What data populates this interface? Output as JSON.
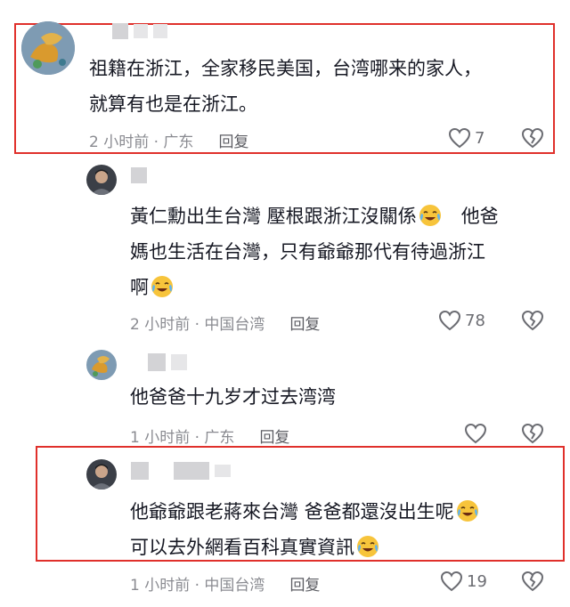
{
  "comments": [
    {
      "id": "c1",
      "lines": [
        "祖籍在浙江，全家移民美国，台湾哪来的家人，",
        "就算有也是在浙江。"
      ],
      "time": "2 小时前 · 广东",
      "reply": "回复",
      "likes": "7",
      "highlighted": true
    },
    {
      "id": "c2",
      "lines": [
        "黃仁勳出生台灣 壓根跟浙江沒關係",
        "他爸",
        "媽也生活在台灣，只有爺爺那代有待過浙江",
        "啊"
      ],
      "time": "2 小时前 · 中国台湾",
      "reply": "回复",
      "likes": "78",
      "highlighted": false
    },
    {
      "id": "c3",
      "lines": [
        "他爸爸十九岁才过去湾湾"
      ],
      "time": "1 小时前 · 广东",
      "reply": "回复",
      "likes": "",
      "highlighted": false
    },
    {
      "id": "c4",
      "lines": [
        "他爺爺跟老蔣來台灣  爸爸都還沒出生呢",
        "可以去外網看百科真實資訊"
      ],
      "time": "1 小时前 · 中国台湾",
      "reply": "回复",
      "likes": "19",
      "highlighted": true
    }
  ],
  "icons": {
    "like": "heart-outline-icon",
    "dislike": "broken-heart-icon",
    "emoji": "tears-of-joy-emoji"
  },
  "colors": {
    "highlight": "#e0302b",
    "meta_text": "#8a8b91",
    "body_text": "#161823"
  }
}
